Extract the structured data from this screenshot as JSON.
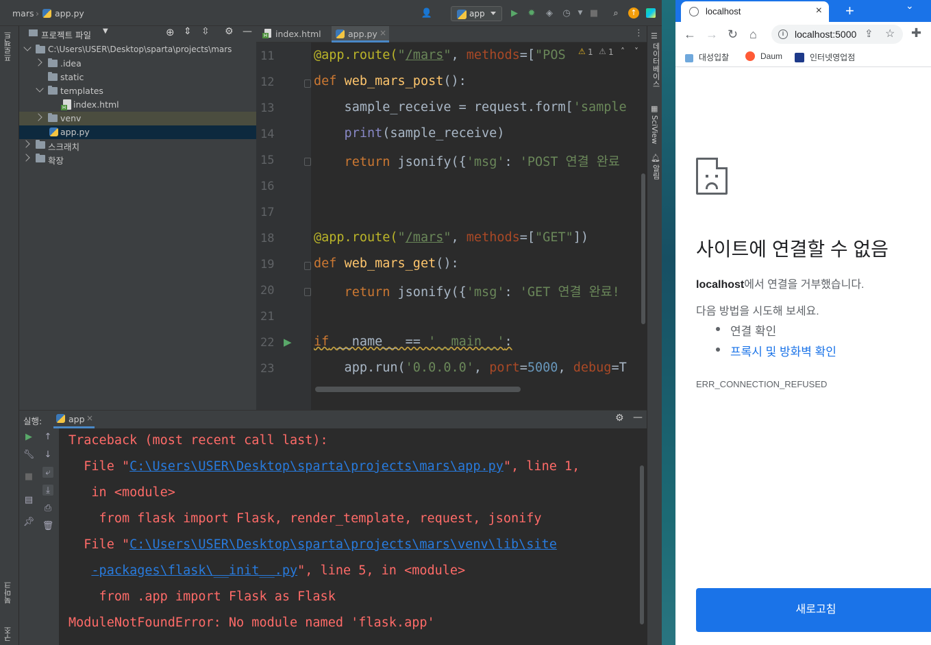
{
  "ide": {
    "breadcrumb": {
      "project": "mars",
      "file": "app.py"
    },
    "run_config": "app",
    "project_panel": {
      "title": "프로젝트 파일",
      "root": "C:\\Users\\USER\\Desktop\\sparta\\projects\\mars",
      "items": [
        ".idea",
        "static",
        "templates",
        "index.html",
        "venv",
        "app.py",
        "스크래치",
        "확장"
      ]
    },
    "left_strip": {
      "top_label": "프로젝트",
      "bottom_label1": "북마크",
      "bottom_label2": "구조"
    },
    "right_strip": {
      "label1": "데이터베이스",
      "label2": "SciView",
      "label3": "알림"
    },
    "tabs": [
      {
        "label": "index.html"
      },
      {
        "label": "app.py"
      }
    ],
    "inspection": {
      "warn1": "1",
      "warn2": "1"
    },
    "line_numbers": [
      "11",
      "12",
      "13",
      "14",
      "15",
      "16",
      "17",
      "18",
      "19",
      "20",
      "21",
      "22",
      "23"
    ],
    "code": {
      "l11_dec": "@app.route(",
      "l11_str1": "\"",
      "l11_route": "/mars",
      "l11_str2": "\"",
      "l11_sep": ", ",
      "l11_pa": "methods",
      "l11_eq": "=[",
      "l11_method": "\"POS",
      "l12_kw": "def ",
      "l12_fn": "web_mars_post",
      "l12_rest": "():",
      "l13_a": "    sample_receive = request.form[",
      "l13_b": "'sample",
      "l14_bi": "    print",
      "l14_rest": "(sample_receive)",
      "l15_kw": "    return ",
      "l15_a": "jsonify({",
      "l15_key": "'msg'",
      "l15_colon": ": ",
      "l15_val": "'POST 연결 완료",
      "l18_dec": "@app.route(",
      "l18_str1": "\"",
      "l18_route": "/mars",
      "l18_str2": "\"",
      "l18_sep": ", ",
      "l18_pa": "methods",
      "l18_eq": "=[",
      "l18_method": "\"GET\"",
      "l18_end": "])",
      "l19_kw": "def ",
      "l19_fn": "web_mars_get",
      "l19_rest": "():",
      "l20_kw": "    return ",
      "l20_a": "jsonify({",
      "l20_key": "'msg'",
      "l20_colon": ": ",
      "l20_val": "'GET 연결 완료!",
      "l22_kw": "if",
      "l22_a": " __name__ == ",
      "l22_str": "'__main__'",
      "l22_end": ":",
      "l23_a": "    app.run(",
      "l23_str": "'0.0.0.0'",
      "l23_sep": ", ",
      "l23_pa": "port",
      "l23_eq": "=",
      "l23_num": "5000",
      "l23_sep2": ", ",
      "l23_pa2": "debug",
      "l23_eq2": "=T"
    },
    "run_panel": {
      "label": "실행:",
      "tab": "app",
      "output": {
        "o1": "Traceback (most recent call last):",
        "o2a": "  File \"",
        "o2link": "C:\\Users\\USER\\Desktop\\sparta\\projects\\mars\\app.py",
        "o2b": "\", line 1,",
        "o3": "   in <module>",
        "o4": "    from flask import Flask, render_template, request, jsonify",
        "o5a": "  File \"",
        "o5link": "C:\\Users\\USER\\Desktop\\sparta\\projects\\mars\\venv\\lib\\site",
        "o6link": "-packages\\flask\\__init__.py",
        "o6b": "\", line 5, in <module>",
        "o7": "    from .app import Flask as Flask",
        "o8": "ModuleNotFoundError: No module named 'flask.app'"
      }
    }
  },
  "browser": {
    "tab_title": "localhost",
    "url": "localhost:5000",
    "bookmarks": [
      "대성입찰",
      "Daum",
      "인터넷영업점"
    ],
    "error": {
      "title": "사이트에 연결할 수 없음",
      "host": "localhost",
      "desc_rest": "에서 연결을 거부했습니다.",
      "try_label": "다음 방법을 시도해 보세요.",
      "suggestion1": "연결 확인",
      "suggestion2": "프록시 및 방화벽 확인",
      "code": "ERR_CONNECTION_REFUSED",
      "reload": "새로고침"
    }
  },
  "colors": {
    "accent": "#1a73e8",
    "error_red": "#ff6b68",
    "link": "#287bde"
  }
}
